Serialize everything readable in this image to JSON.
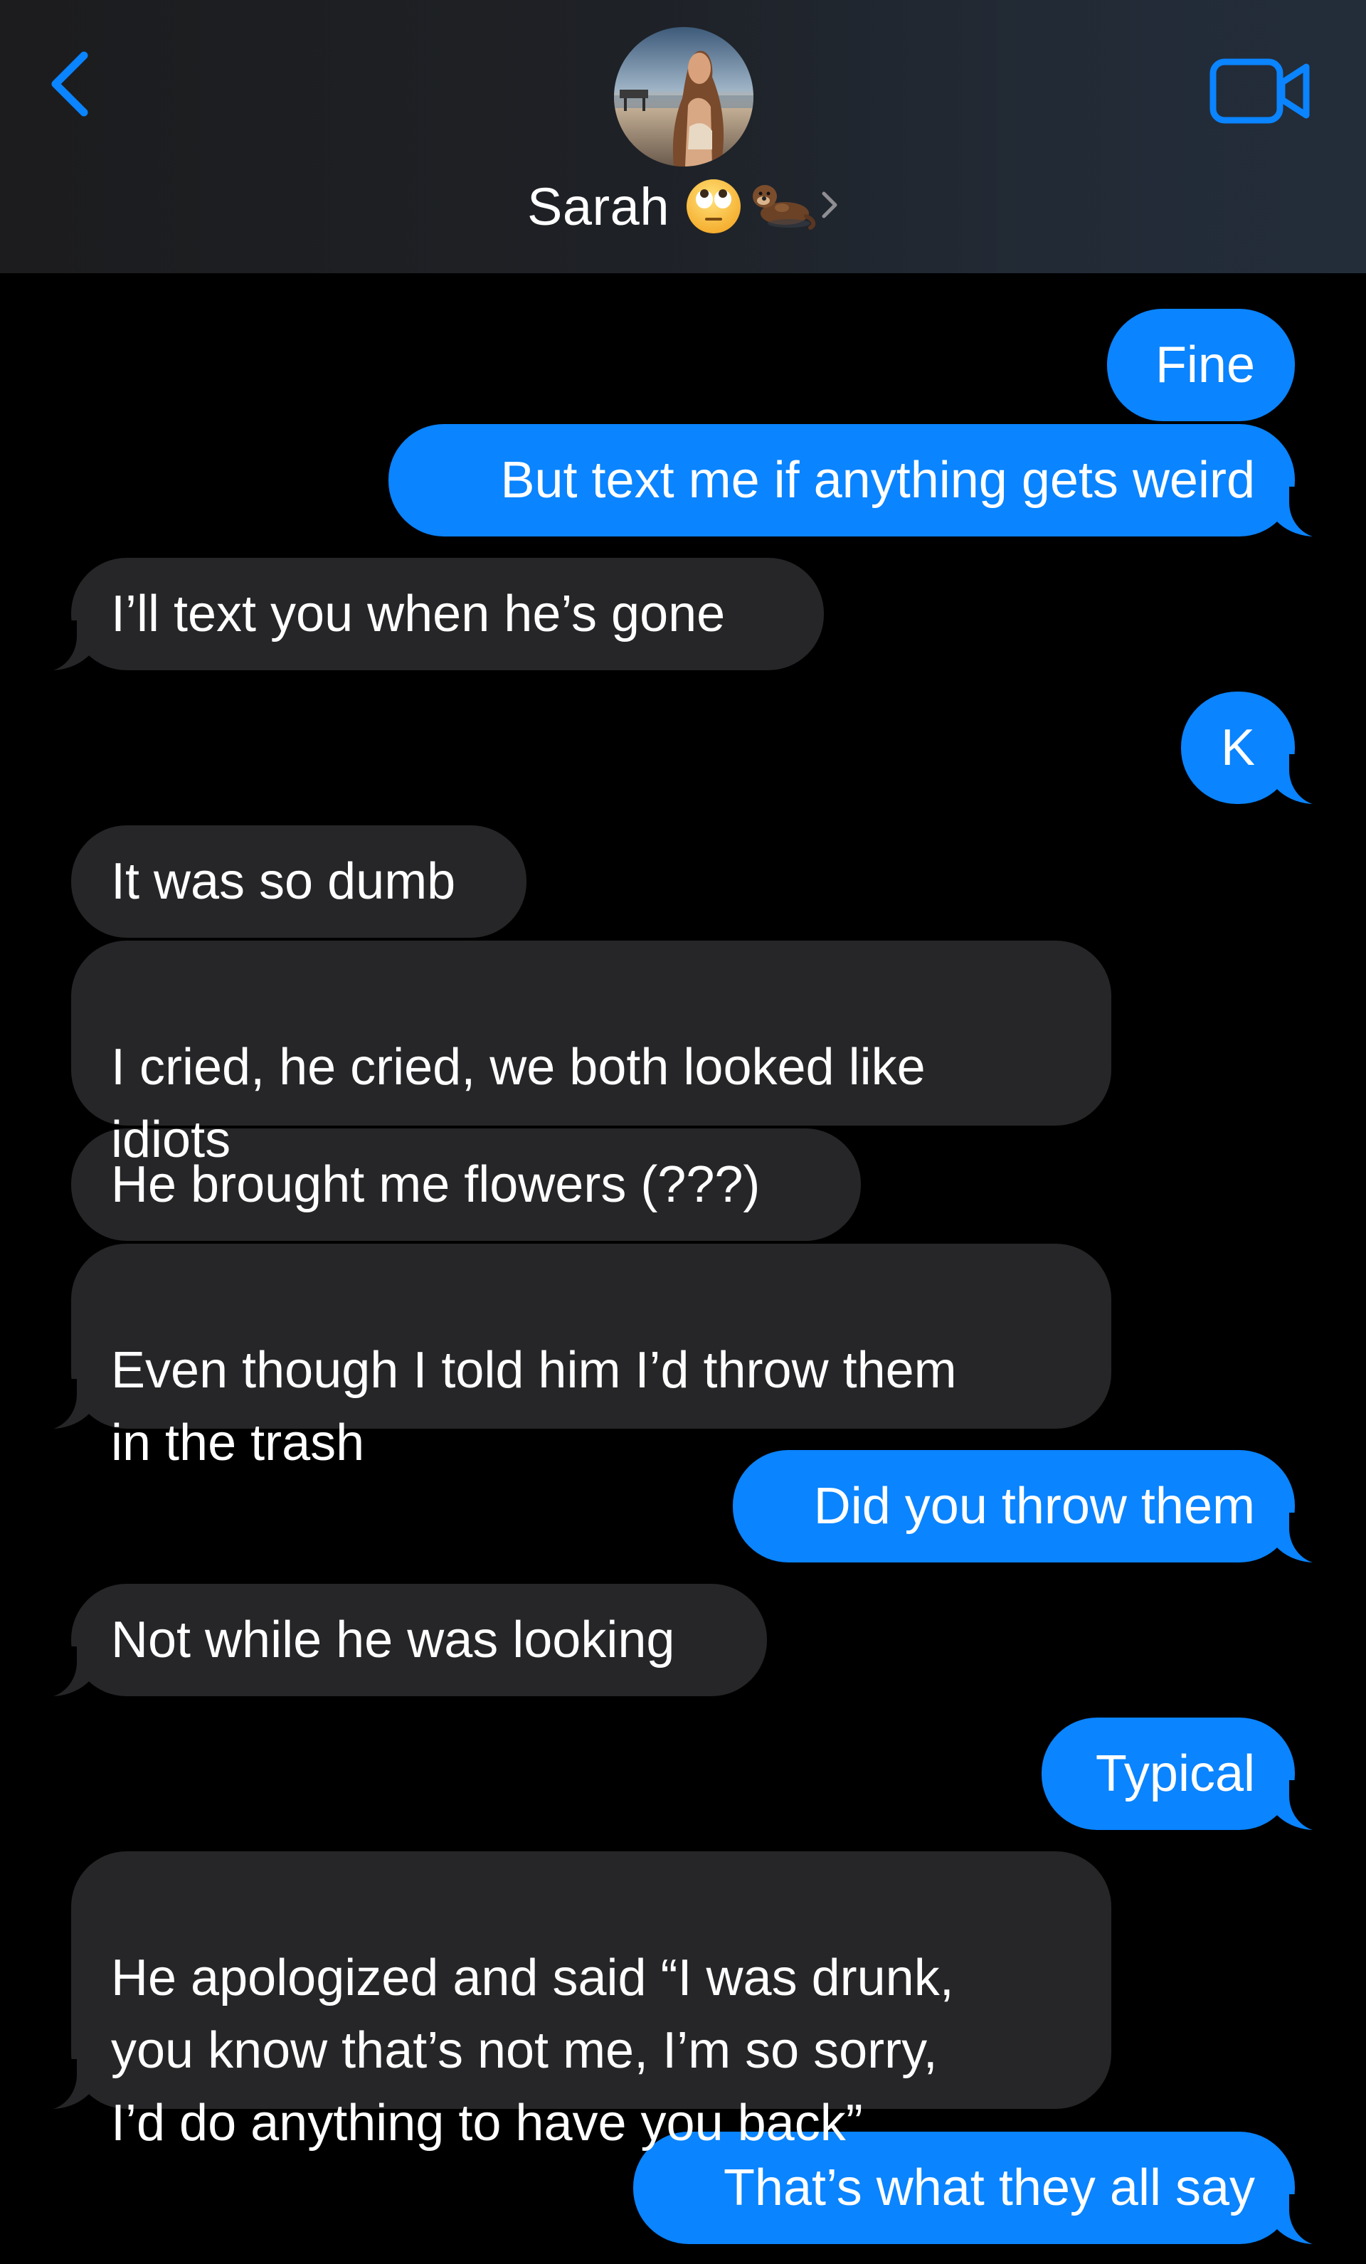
{
  "header": {
    "contact_name": "Sarah",
    "emojis": [
      "face-with-rolling-eyes",
      "otter"
    ],
    "accent_color": "#0a84ff",
    "avatar_alt": "Sarah profile photo"
  },
  "colors": {
    "sent_bubble": "#0a84ff",
    "received_bubble": "#262628",
    "background": "#000000"
  },
  "messages": [
    {
      "direction": "sent",
      "text": "Fine"
    },
    {
      "direction": "sent",
      "text": "But text me if anything gets weird"
    },
    {
      "direction": "received",
      "text": "I’ll text you when he’s gone"
    },
    {
      "direction": "sent",
      "text": "K"
    },
    {
      "direction": "received",
      "text": "It was so dumb"
    },
    {
      "direction": "received",
      "text": "I cried, he cried, we both looked like\nidiots"
    },
    {
      "direction": "received",
      "text": "He brought me flowers (???)"
    },
    {
      "direction": "received",
      "text": "Even though I told him I’d throw them\nin the trash"
    },
    {
      "direction": "sent",
      "text": "Did you throw them"
    },
    {
      "direction": "received",
      "text": "Not while he was looking"
    },
    {
      "direction": "sent",
      "text": "Typical"
    },
    {
      "direction": "received",
      "text": "He apologized and said “I was drunk,\nyou know that’s not me, I’m so sorry,\nI’d do anything to have you back”"
    },
    {
      "direction": "sent",
      "text": "That’s what they all say"
    }
  ]
}
